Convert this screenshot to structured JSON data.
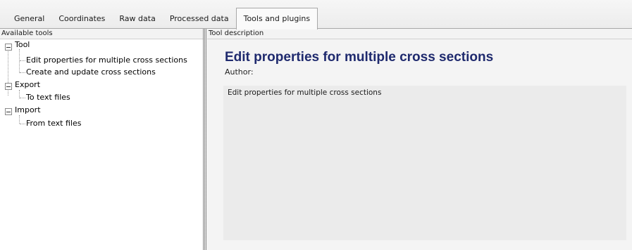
{
  "tabs": [
    {
      "label": "General",
      "active": false
    },
    {
      "label": "Coordinates",
      "active": false
    },
    {
      "label": "Raw data",
      "active": false
    },
    {
      "label": "Processed data",
      "active": false
    },
    {
      "label": "Tools and plugins",
      "active": true
    }
  ],
  "left_panel": {
    "caption": "Available tools",
    "tree": [
      {
        "label": "Tool",
        "children": [
          "Edit properties for multiple cross sections",
          "Create and update cross sections"
        ]
      },
      {
        "label": "Export",
        "children": [
          "To text files"
        ]
      },
      {
        "label": "Import",
        "children": [
          "From text files"
        ]
      }
    ]
  },
  "right_panel": {
    "caption": "Tool description",
    "title": "Edit properties for multiple cross sections",
    "author_label": "Author:",
    "description": "Edit properties for multiple cross sections"
  },
  "colors": {
    "title": "#1f2a6e",
    "tab_border": "#a8a8a8",
    "description_background": "#ebebeb"
  }
}
